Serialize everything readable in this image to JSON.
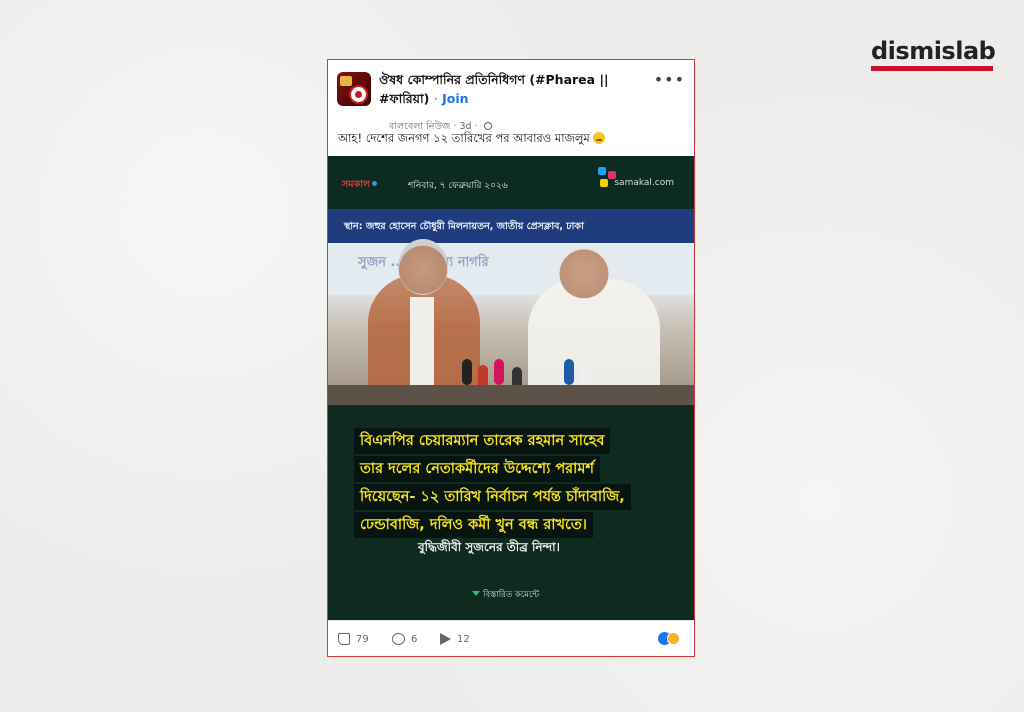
{
  "brand": {
    "logo_text": "dismislab",
    "accent_color": "#c8102e"
  },
  "post": {
    "group_name": "ঔষধ কোম্পানির প্রতিনিধিগণ (#Pharea || #ফারিয়া)",
    "dot": "·",
    "join_label": "Join",
    "author": "বালবেলা নিউজ",
    "time": "3d",
    "more_icon": "more-horizontal-icon",
    "text": "আহ! দেশের জনগণ ১২ তারিখের পর আবারও মাজলুম",
    "emoji_icon": "sad-face-emoji-icon"
  },
  "image": {
    "source_logo": "সমকাল",
    "date": "শনিবার, ৭ ফেব্রুয়ারি ২০২৬",
    "site": "samakal.com",
    "venue": "স্থান: জহুর হোসেন চৌধুরী মিলনায়তন, জাতীয় প্রেসক্লাব, ঢাকা",
    "banner": "সুজন ...নের জন্য নাগরি",
    "headline_lines": [
      "বিএনপির চেয়ারম্যান তারেক রহমান সাহেব",
      "তার দলের নেতাকর্মীদের উদ্দেশ্যে পরামর্শ",
      "দিয়েছেন- ১২ তারিখ নির্বাচন পর্যন্ত চাঁদাবাজি,",
      "ঢেন্ডাবাজি, দলিও কর্মী খুন বন্ধ রাখতে।"
    ],
    "subline": "বুদ্ধিজীবী সুজনের তীব্র নিন্দা।",
    "comment_hint": "বিস্তারিত কমেন্টে",
    "headline_color": "#f5e21a"
  },
  "footer": {
    "likes": "79",
    "comments": "6",
    "shares": "12"
  }
}
